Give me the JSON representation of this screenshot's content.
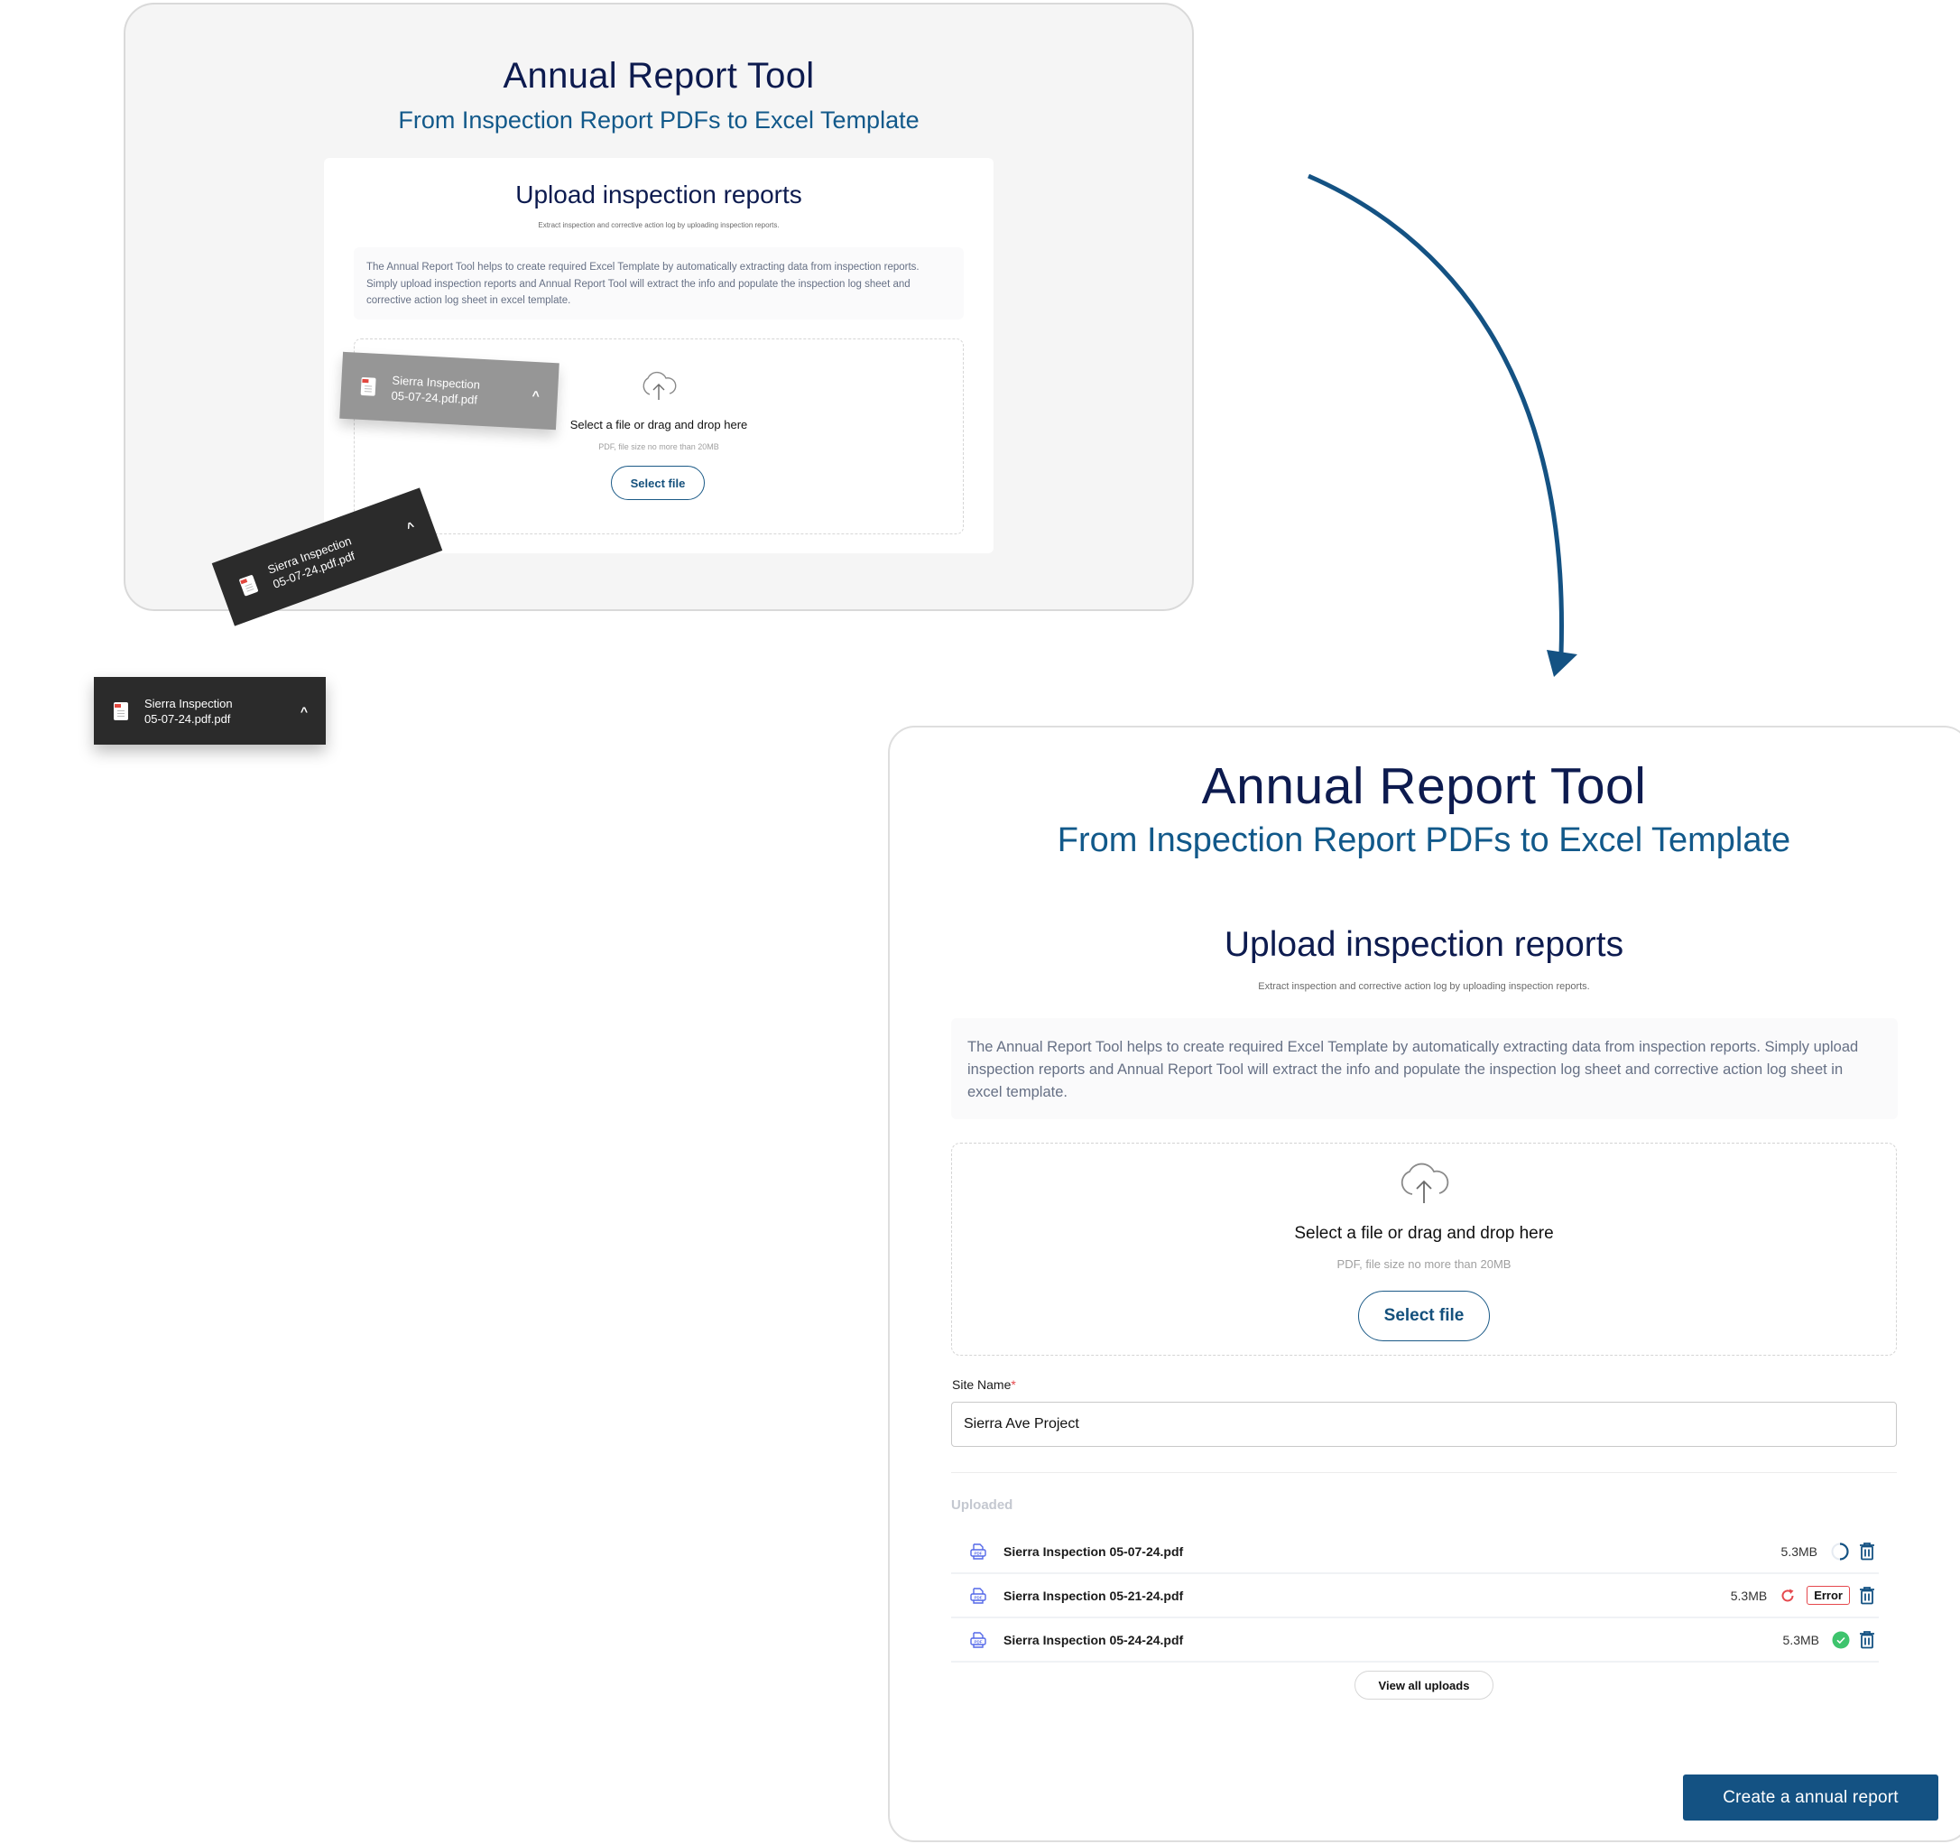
{
  "before_panel": {
    "title": "Annual Report Tool",
    "subtitle": "From Inspection Report PDFs to Excel Template",
    "card_title": "Upload inspection reports",
    "card_caption": "Extract inspection and corrective action log by uploading inspection reports.",
    "info_text": "The Annual Report Tool helps to create required Excel Template by automatically extracting data from inspection reports. Simply upload inspection reports and Annual Report Tool will extract the info and populate the inspection log sheet and corrective action log sheet in excel template.",
    "dropzone": {
      "icon": "cloud-upload-icon",
      "title": "Select a file or drag and drop here",
      "hint": "PDF, file size no more than 20MB",
      "button_label": "Select file"
    }
  },
  "drag_chips": [
    {
      "line1": "Sierra Inspection",
      "line2": "05-07-24.pdf.pdf",
      "icon": "pdf-file-icon",
      "caret": "^",
      "state": "ghost"
    },
    {
      "line1": "Sierra Inspection",
      "line2": "05-07-24.pdf.pdf",
      "icon": "pdf-file-icon",
      "caret": "^",
      "state": "dragging"
    },
    {
      "line1": "Sierra Inspection",
      "line2": "05-07-24.pdf.pdf",
      "icon": "pdf-file-icon",
      "caret": "^",
      "state": "download-chip"
    }
  ],
  "flow_arrow": {
    "color": "#145283",
    "direction": "down"
  },
  "after_panel": {
    "title": "Annual Report Tool",
    "subtitle": "From Inspection Report PDFs to Excel Template",
    "card_title": "Upload inspection reports",
    "card_caption": "Extract inspection and corrective action log by uploading inspection reports.",
    "info_text": "The Annual Report Tool helps to create required Excel Template by automatically extracting data from inspection reports. Simply upload inspection reports and Annual Report Tool will extract the info and populate the inspection log sheet and corrective action log sheet in excel template.",
    "dropzone": {
      "icon": "cloud-upload-icon",
      "title": "Select a file or drag and drop here",
      "hint": "PDF, file size no more than 20MB",
      "button_label": "Select file"
    },
    "site_name": {
      "label": "Site Name",
      "required_mark": "*",
      "value": "Sierra Ave Project"
    },
    "uploaded_heading": "Uploaded",
    "files": [
      {
        "name": "Sierra Inspection 05-07-24.pdf",
        "size": "5.3MB",
        "status": "uploading"
      },
      {
        "name": "Sierra Inspection 05-21-24.pdf",
        "size": "5.3MB",
        "status": "error",
        "status_label": "Error"
      },
      {
        "name": "Sierra Inspection 05-24-24.pdf",
        "size": "5.3MB",
        "status": "success"
      }
    ],
    "view_all_label": "View all uploads",
    "create_label": "Create a annual report"
  },
  "colors": {
    "navy_title": "#0d1b4f",
    "brand_blue": "#145283",
    "subtitle_blue": "#12598a",
    "error_red": "#e5484d",
    "success_green": "#3ec46d",
    "pdf_icon_blue": "#5468e8"
  }
}
